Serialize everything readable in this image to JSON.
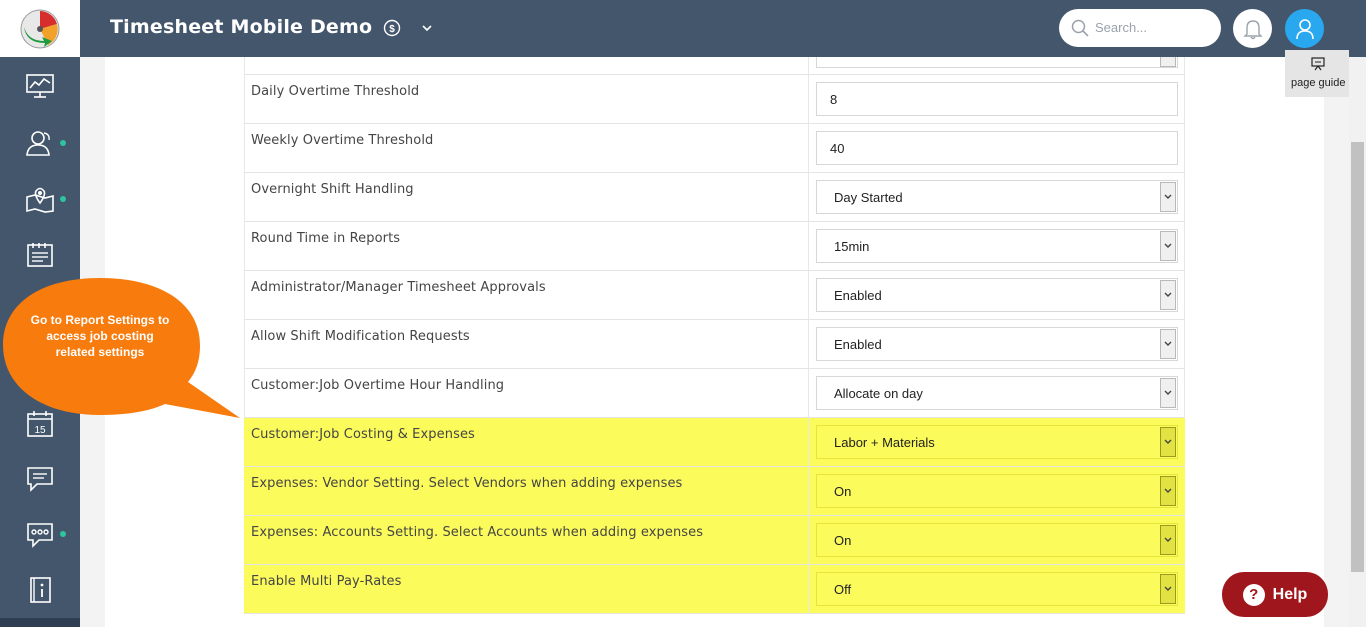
{
  "header": {
    "app_title": "Timesheet Mobile Demo",
    "search_placeholder": "Search..."
  },
  "sidebar": {
    "items": [
      {
        "icon": "dashboard-chart-icon",
        "dot": false
      },
      {
        "icon": "users-icon",
        "dot": true
      },
      {
        "icon": "map-location-icon",
        "dot": true
      },
      {
        "icon": "timesheet-icon",
        "dot": false
      },
      {
        "icon": "calendar-icon",
        "calendar_day": "15",
        "dot": false
      },
      {
        "icon": "messages-icon",
        "dot": false
      },
      {
        "icon": "more-chat-icon",
        "dot": true
      },
      {
        "icon": "info-book-icon",
        "dot": false
      }
    ]
  },
  "page_guide": {
    "label": "page guide"
  },
  "settings": [
    {
      "label": "Daily Overtime Threshold",
      "type": "input",
      "value": "8",
      "highlighted": false
    },
    {
      "label": "Weekly Overtime Threshold",
      "type": "input",
      "value": "40",
      "highlighted": false
    },
    {
      "label": "Overnight Shift Handling",
      "type": "select",
      "value": "Day Started",
      "highlighted": false
    },
    {
      "label": "Round Time in Reports",
      "type": "select",
      "value": "15min",
      "highlighted": false
    },
    {
      "label": "Administrator/Manager Timesheet Approvals",
      "type": "select",
      "value": "Enabled",
      "highlighted": false
    },
    {
      "label": "Allow Shift Modification Requests",
      "type": "select",
      "value": "Enabled",
      "highlighted": false
    },
    {
      "label": "Customer:Job Overtime Hour Handling",
      "type": "select",
      "value": "Allocate on day",
      "highlighted": false
    },
    {
      "label": "Customer:Job Costing & Expenses",
      "type": "select",
      "value": "Labor + Materials",
      "highlighted": true
    },
    {
      "label": "Expenses: Vendor Setting. Select Vendors when adding expenses",
      "type": "select",
      "value": "On",
      "highlighted": true
    },
    {
      "label": "Expenses: Accounts Setting. Select Accounts when adding expenses",
      "type": "select",
      "value": "On",
      "highlighted": true
    },
    {
      "label": "Enable Multi Pay-Rates",
      "type": "select",
      "value": "Off",
      "highlighted": true
    }
  ],
  "callout": {
    "text": "Go to Report Settings to access job costing related settings",
    "color": "#f77b0d"
  },
  "help_button": {
    "label": "Help",
    "glyph": "?"
  },
  "colors": {
    "header": "#44566c",
    "highlight": "#fbfb5b",
    "help": "#a0161d",
    "user_avatar": "#29a8f0"
  }
}
